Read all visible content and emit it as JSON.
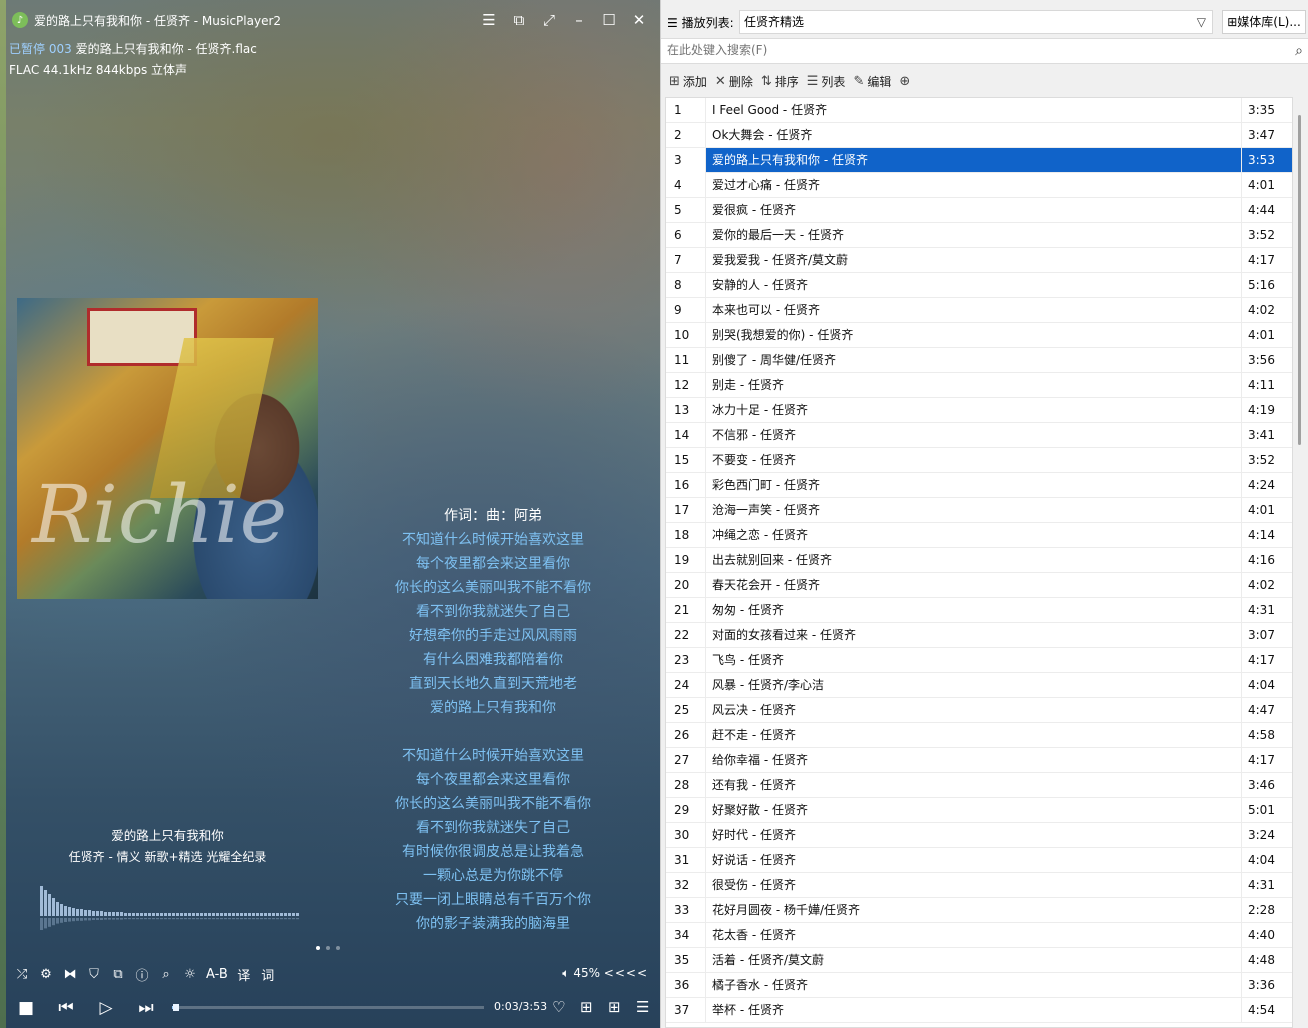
{
  "window": {
    "title": "爱的路上只有我和你 - 任贤齐 - MusicPlayer2",
    "app_icon": "music-note-icon"
  },
  "status": {
    "state": "已暂停",
    "track_no": "003",
    "file": "爱的路上只有我和你 - 任贤齐.flac",
    "format": "FLAC 44.1kHz 844kbps 立体声"
  },
  "now_playing": {
    "title": "爱的路上只有我和你",
    "subtitle": "任贤齐 - 情义 新歌+精选 光耀全纪录"
  },
  "lyrics": [
    "作词：曲：阿弟",
    "不知道什么时候开始喜欢这里",
    "每个夜里都会来这里看你",
    "你长的这么美丽叫我不能不看你",
    "看不到你我就迷失了自己",
    "好想牵你的手走过风风雨雨",
    "有什么困难我都陪着你",
    "直到天长地久直到天荒地老",
    "爱的路上只有我和你",
    "",
    "不知道什么时候开始喜欢这里",
    "每个夜里都会来这里看你",
    "你长的这么美丽叫我不能不看你",
    "看不到你我就迷失了自己",
    "有时候你很调皮总是让我着急",
    "一颗心总是为你跳不停",
    "只要一闭上眼睛总有千百万个你",
    "你的影子装满我的脑海里"
  ],
  "toolbar": {
    "ab_label": "A-B",
    "translate_label": "译",
    "lyric_label": "词",
    "volume": "45%",
    "arrows": "<<<<"
  },
  "playback": {
    "time": "0:03/3:53",
    "progress": 0.013
  },
  "playlist": {
    "label": "播放列表:",
    "current": "任贤齐精选",
    "media_lib": "媒体库(L)...",
    "search_placeholder": "在此处键入搜索(F)",
    "actions": {
      "add": "添加",
      "delete": "删除",
      "sort": "排序",
      "list": "列表",
      "edit": "编辑"
    },
    "selected_index": 2,
    "rows": [
      {
        "n": "1",
        "name": "I Feel Good - 任贤齐",
        "dur": "3:35"
      },
      {
        "n": "2",
        "name": "Ok大舞会 - 任贤齐",
        "dur": "3:47"
      },
      {
        "n": "3",
        "name": "爱的路上只有我和你 - 任贤齐",
        "dur": "3:53"
      },
      {
        "n": "4",
        "name": "爱过才心痛 - 任贤齐",
        "dur": "4:01"
      },
      {
        "n": "5",
        "name": "爱很疯 - 任贤齐",
        "dur": "4:44"
      },
      {
        "n": "6",
        "name": "爱你的最后一天 - 任贤齐",
        "dur": "3:52"
      },
      {
        "n": "7",
        "name": "爱我爱我 - 任贤齐/莫文蔚",
        "dur": "4:17"
      },
      {
        "n": "8",
        "name": "安静的人 - 任贤齐",
        "dur": "5:16"
      },
      {
        "n": "9",
        "name": "本来也可以 - 任贤齐",
        "dur": "4:02"
      },
      {
        "n": "10",
        "name": "别哭(我想爱的你) - 任贤齐",
        "dur": "4:01"
      },
      {
        "n": "11",
        "name": "别傻了 - 周华健/任贤齐",
        "dur": "3:56"
      },
      {
        "n": "12",
        "name": "别走 - 任贤齐",
        "dur": "4:11"
      },
      {
        "n": "13",
        "name": "冰力十足 - 任贤齐",
        "dur": "4:19"
      },
      {
        "n": "14",
        "name": "不信邪 - 任贤齐",
        "dur": "3:41"
      },
      {
        "n": "15",
        "name": "不要变 - 任贤齐",
        "dur": "3:52"
      },
      {
        "n": "16",
        "name": "彩色西门町 - 任贤齐",
        "dur": "4:24"
      },
      {
        "n": "17",
        "name": "沧海一声笑 - 任贤齐",
        "dur": "4:01"
      },
      {
        "n": "18",
        "name": "冲绳之恋 - 任贤齐",
        "dur": "4:14"
      },
      {
        "n": "19",
        "name": "出去就别回来 - 任贤齐",
        "dur": "4:16"
      },
      {
        "n": "20",
        "name": "春天花会开 - 任贤齐",
        "dur": "4:02"
      },
      {
        "n": "21",
        "name": "匆匆 - 任贤齐",
        "dur": "4:31"
      },
      {
        "n": "22",
        "name": "对面的女孩看过来 - 任贤齐",
        "dur": "3:07"
      },
      {
        "n": "23",
        "name": "飞鸟 - 任贤齐",
        "dur": "4:17"
      },
      {
        "n": "24",
        "name": "风暴 - 任贤齐/李心洁",
        "dur": "4:04"
      },
      {
        "n": "25",
        "name": "风云决 - 任贤齐",
        "dur": "4:47"
      },
      {
        "n": "26",
        "name": "赶不走 - 任贤齐",
        "dur": "4:58"
      },
      {
        "n": "27",
        "name": "给你幸福 - 任贤齐",
        "dur": "4:17"
      },
      {
        "n": "28",
        "name": "还有我 - 任贤齐",
        "dur": "3:46"
      },
      {
        "n": "29",
        "name": "好聚好散 - 任贤齐",
        "dur": "5:01"
      },
      {
        "n": "30",
        "name": "好时代 - 任贤齐",
        "dur": "3:24"
      },
      {
        "n": "31",
        "name": "好说话 - 任贤齐",
        "dur": "4:04"
      },
      {
        "n": "32",
        "name": "很受伤 - 任贤齐",
        "dur": "4:31"
      },
      {
        "n": "33",
        "name": "花好月圆夜 - 杨千嬅/任贤齐",
        "dur": "2:28"
      },
      {
        "n": "34",
        "name": "花太香 - 任贤齐",
        "dur": "4:40"
      },
      {
        "n": "35",
        "name": "活着 - 任贤齐/莫文蔚",
        "dur": "4:48"
      },
      {
        "n": "36",
        "name": "橘子香水 - 任贤齐",
        "dur": "3:36"
      },
      {
        "n": "37",
        "name": "举杯 - 任贤齐",
        "dur": "4:54"
      }
    ]
  },
  "colors": {
    "accent": "#1063c9",
    "lyric": "#7ec1f2",
    "paused": "#9fd0ff"
  }
}
